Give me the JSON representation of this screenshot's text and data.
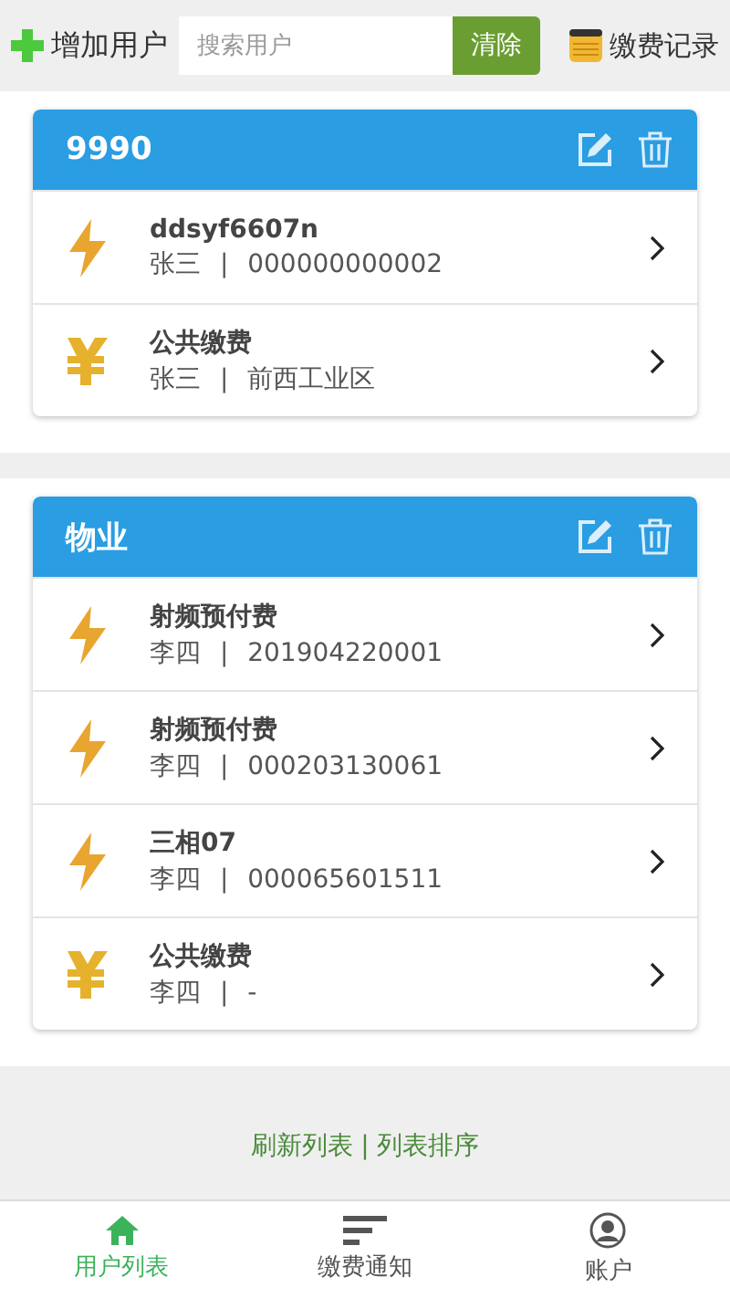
{
  "toolbar": {
    "add_user": "增加用户",
    "search": {
      "placeholder": "搜索用户"
    },
    "clear_button": "清除",
    "records": "缴费记录"
  },
  "groups": [
    {
      "title": "9990",
      "items": [
        {
          "kind": "electric",
          "name": "ddsyf6607n",
          "detail": "张三 | 000000000002"
        },
        {
          "kind": "public",
          "name": "公共缴费",
          "detail": "张三 | 前西工业区"
        }
      ]
    },
    {
      "title": "物业",
      "items": [
        {
          "kind": "electric",
          "name": "射频预付费",
          "detail": "李四 | 201904220001"
        },
        {
          "kind": "electric",
          "name": "射频预付费",
          "detail": "李四 | 000203130061"
        },
        {
          "kind": "electric",
          "name": "三相07",
          "detail": "李四 | 000065601511"
        },
        {
          "kind": "public",
          "name": "公共缴费",
          "detail": "李四 | -"
        }
      ]
    }
  ],
  "footer_links": {
    "refresh": "刷新列表",
    "separator": "|",
    "sort": "列表排序"
  },
  "tabs": [
    {
      "label": "用户列表",
      "selected": true
    },
    {
      "label": "缴费通知",
      "selected": false
    },
    {
      "label": "账户",
      "selected": false
    }
  ]
}
